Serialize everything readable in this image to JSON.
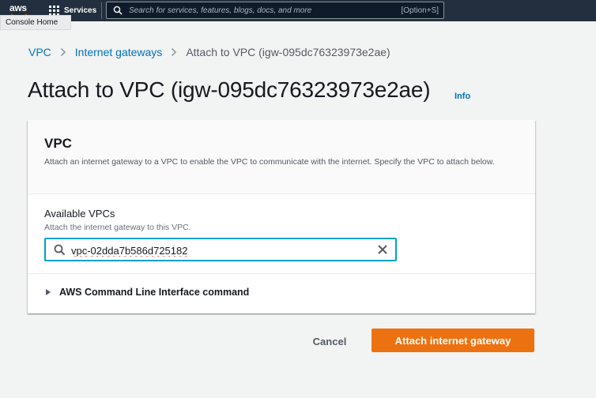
{
  "topnav": {
    "logo": "aws",
    "services_label": "Services",
    "search_placeholder": "Search for services, features, blogs, docs, and more",
    "search_shortcut": "[Option+S]"
  },
  "tooltip": "Console Home",
  "breadcrumb": {
    "items": [
      "VPC",
      "Internet gateways",
      "Attach to VPC (igw-095dc76323973e2ae)"
    ]
  },
  "page": {
    "title": "Attach to VPC (igw-095dc76323973e2ae)",
    "info": "Info"
  },
  "panel": {
    "title": "VPC",
    "description": "Attach an internet gateway to a VPC to enable the VPC to communicate with the internet. Specify the VPC to attach below.",
    "field_label": "Available VPCs",
    "field_description": "Attach the internet gateway to this VPC.",
    "field_value": "vpc-02dda7b586d725182",
    "cli_label": "AWS Command Line Interface command"
  },
  "actions": {
    "cancel": "Cancel",
    "primary": "Attach internet gateway"
  },
  "colors": {
    "nav_bg": "#232f3e",
    "link": "#0073bb",
    "primary": "#ec7211",
    "focus": "#00a1c9"
  },
  "icons": [
    "grid-icon",
    "search-icon",
    "chevron-right-icon",
    "clear-icon",
    "caret-right-icon"
  ]
}
